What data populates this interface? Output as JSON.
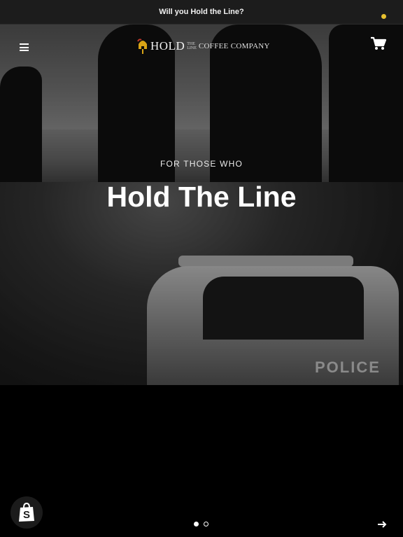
{
  "announcement": {
    "text": "Will you Hold the Line?"
  },
  "header": {
    "logo": {
      "hold": "HOLD",
      "the": "THE",
      "line": "LINE",
      "company": "COFFEE COMPANY"
    },
    "cart_badge_color": "#e8c12f"
  },
  "hero": {
    "eyebrow": "FOR THOSE WHO",
    "headline": "Hold The Line",
    "background_text": "POLICE"
  },
  "slideshow": {
    "total_slides": 2,
    "active_slide": 1
  },
  "icons": {
    "menu": "hamburger-menu-icon",
    "cart": "shopping-cart-icon",
    "next": "arrow-right-icon",
    "shopify": "shopify-bag-icon"
  }
}
